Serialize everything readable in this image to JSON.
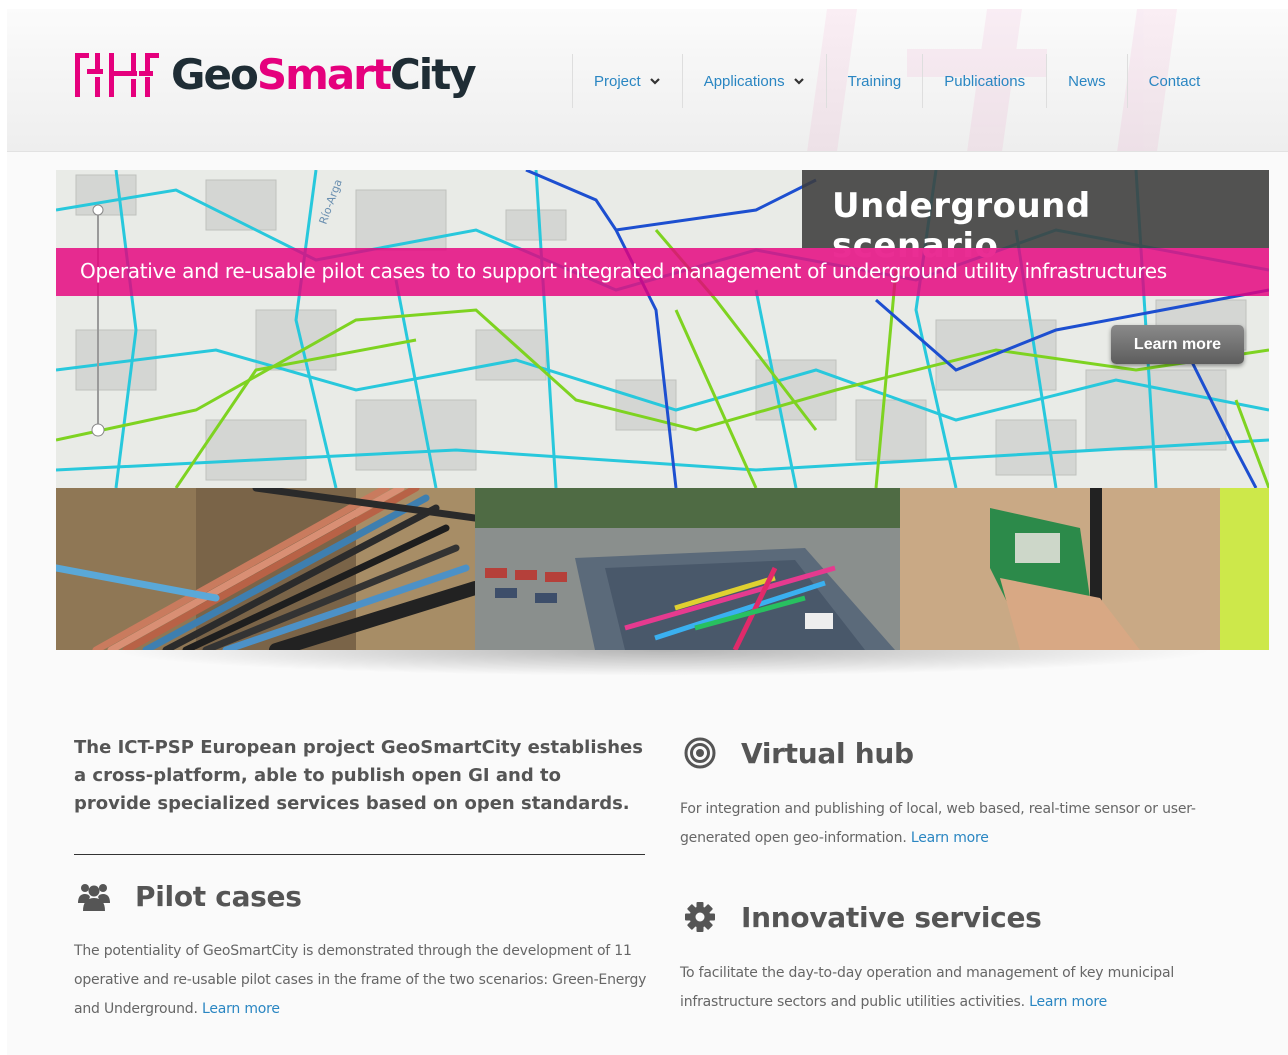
{
  "brand": {
    "logo_text_geo": "Geo",
    "logo_text_smart": "Smart",
    "logo_text_city": "City",
    "colors": {
      "magenta": "#e5007d",
      "dark": "#1f2d35",
      "link": "#2a86c2"
    }
  },
  "nav": {
    "items": [
      {
        "label": "Project",
        "dropdown": true
      },
      {
        "label": "Applications",
        "dropdown": true
      },
      {
        "label": "Training",
        "dropdown": false
      },
      {
        "label": "Publications",
        "dropdown": false
      },
      {
        "label": "News",
        "dropdown": false
      },
      {
        "label": "Contact",
        "dropdown": false
      }
    ]
  },
  "slider": {
    "title": "Underground scenario",
    "subtitle": "Operative and re-usable pilot cases to to support integrated management of underground utility infrastructures",
    "button_label": "Learn more",
    "map_label": "Río-Arga"
  },
  "intro": {
    "text": "The ICT-PSP European project GeoSmartCity establishes a cross-platform, able to publish open GI and to provide specialized services based on open standards."
  },
  "features": {
    "pilot": {
      "icon": "users-icon",
      "title": "Pilot cases",
      "text": "The potentiality of GeoSmartCity  is demonstrated through the development of 11 operative and re-usable pilot cases in the frame of the two scenarios: Green-Energy and Underground.",
      "link": "Learn more"
    },
    "hub": {
      "icon": "target-icon",
      "title": "Virtual hub",
      "text": "For integration and publishing of local, web based, real-time sensor or user-generated open geo-information.",
      "link": "Learn more"
    },
    "services": {
      "icon": "gear-icon",
      "title": "Innovative services",
      "text": "To facilitate the day-to-day operation and management of key municipal infrastructure sectors and public utilities activities.",
      "link": "Learn more"
    }
  }
}
